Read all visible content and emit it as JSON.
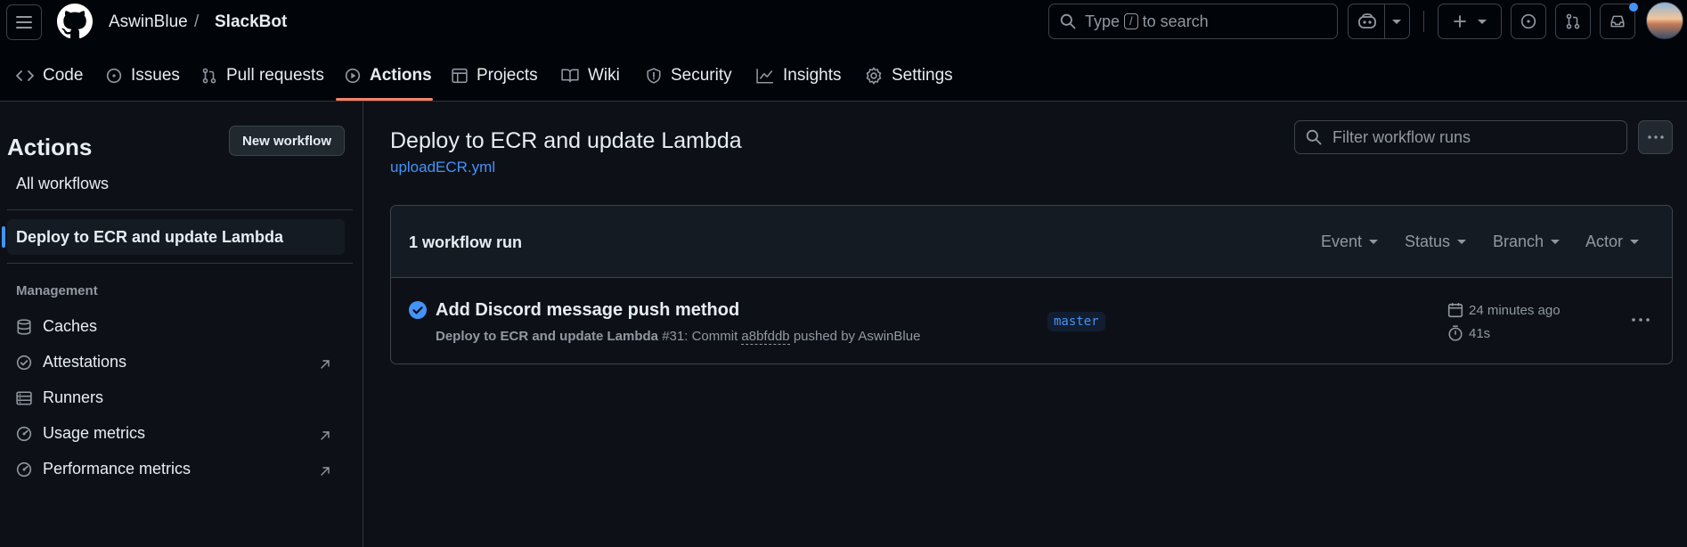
{
  "header": {
    "owner": "AswinBlue",
    "separator": "/",
    "repo": "SlackBot",
    "search": {
      "prefix": "Type",
      "kbd": "/",
      "suffix": "to search"
    }
  },
  "tabs": [
    {
      "label": "Code",
      "icon": "code-icon"
    },
    {
      "label": "Issues",
      "icon": "issue-icon"
    },
    {
      "label": "Pull requests",
      "icon": "pull-request-icon"
    },
    {
      "label": "Actions",
      "icon": "play-icon",
      "active": true
    },
    {
      "label": "Projects",
      "icon": "table-icon"
    },
    {
      "label": "Wiki",
      "icon": "book-icon"
    },
    {
      "label": "Security",
      "icon": "shield-icon"
    },
    {
      "label": "Insights",
      "icon": "graph-icon"
    },
    {
      "label": "Settings",
      "icon": "gear-icon"
    }
  ],
  "sidebar": {
    "title": "Actions",
    "new_workflow": "New workflow",
    "all_workflows": "All workflows",
    "selected_workflow": "Deploy to ECR and update Lambda",
    "management_heading": "Management",
    "management_items": [
      {
        "label": "Caches",
        "icon": "database-icon",
        "external": false
      },
      {
        "label": "Attestations",
        "icon": "verified-icon",
        "external": true
      },
      {
        "label": "Runners",
        "icon": "server-icon",
        "external": false
      },
      {
        "label": "Usage metrics",
        "icon": "meter-icon",
        "external": true
      },
      {
        "label": "Performance metrics",
        "icon": "meter-icon",
        "external": true
      }
    ]
  },
  "main": {
    "workflow_title": "Deploy to ECR and update Lambda",
    "workflow_file": "uploadECR.yml",
    "filter_placeholder": "Filter workflow runs",
    "run_count": "1 workflow run",
    "filters": [
      "Event",
      "Status",
      "Branch",
      "Actor"
    ],
    "run": {
      "title": "Add Discord message push method",
      "workflow_name": "Deploy to ECR and update Lambda",
      "run_number": "#31",
      "commit_prefix": ": Commit",
      "commit_sha": "a8bfddb",
      "pushed_by": "pushed by AswinBlue",
      "branch": "master",
      "time_ago": "24 minutes ago",
      "duration": "41s",
      "status": "success"
    }
  },
  "colors": {
    "accent": "#4493f8",
    "tab_underline": "#f78166",
    "success": "#4493f8",
    "background": "#0d1117",
    "header_background": "#010409"
  }
}
